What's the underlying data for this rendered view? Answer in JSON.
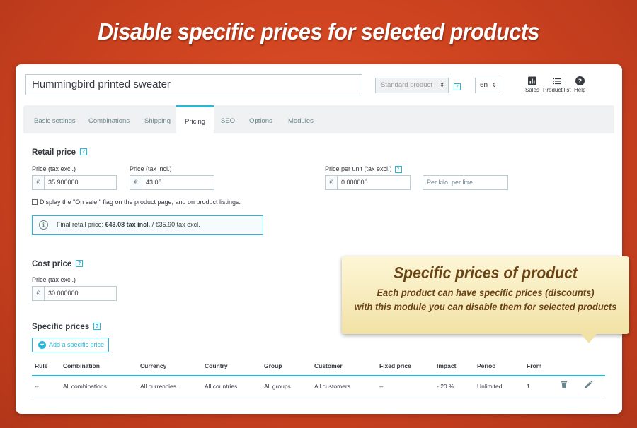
{
  "banner": {
    "title": "Disable specific prices for selected products"
  },
  "header": {
    "product_name": "Hummingbird printed sweater",
    "product_type": "Standard product",
    "language": "en",
    "links": [
      {
        "label": "Sales",
        "icon": "bar-chart-icon"
      },
      {
        "label": "Product list",
        "icon": "list-icon"
      },
      {
        "label": "Help",
        "icon": "help-circle-icon"
      }
    ]
  },
  "tabs": [
    {
      "label": "Basic settings"
    },
    {
      "label": "Combinations"
    },
    {
      "label": "Shipping"
    },
    {
      "label": "Pricing",
      "active": true
    },
    {
      "label": "SEO"
    },
    {
      "label": "Options"
    },
    {
      "label": "Modules"
    }
  ],
  "retail": {
    "title": "Retail price",
    "help": "?",
    "excl_label": "Price (tax excl.)",
    "excl_currency": "€",
    "excl_value": "35.900000",
    "incl_label": "Price (tax incl.)",
    "incl_currency": "€",
    "incl_value": "43.08",
    "unit_label": "Price per unit (tax excl.)",
    "unit_currency": "€",
    "unit_value": "0.000000",
    "unit_placeholder": "Per kilo, per litre",
    "on_sale_label": "Display the \"On sale!\" flag on the product page, and on product listings.",
    "final_prefix": "Final retail price:",
    "final_incl": "€43.08 tax incl.",
    "final_suffix": "/ €35.90 tax excl."
  },
  "cost": {
    "title": "Cost price",
    "help": "?",
    "label": "Price (tax excl.)",
    "currency": "€",
    "value": "30.000000"
  },
  "specific": {
    "title": "Specific prices",
    "help": "?",
    "add_label": "Add a specific price",
    "columns": [
      "Rule",
      "Combination",
      "Currency",
      "Country",
      "Group",
      "Customer",
      "Fixed price",
      "Impact",
      "Period",
      "From"
    ],
    "rows": [
      [
        "--",
        "All combinations",
        "All currencies",
        "All countries",
        "All groups",
        "All customers",
        "--",
        "- 20 %",
        "Unlimited",
        "1"
      ]
    ]
  },
  "callout": {
    "title": "Specific prices of product",
    "line1": "Each product can have specific prices (discounts)",
    "line2": "with this module you can disable them for selected products"
  },
  "colors": {
    "accent": "#25b9d7",
    "background": "#cf4420",
    "callout_text": "#6b4416"
  }
}
